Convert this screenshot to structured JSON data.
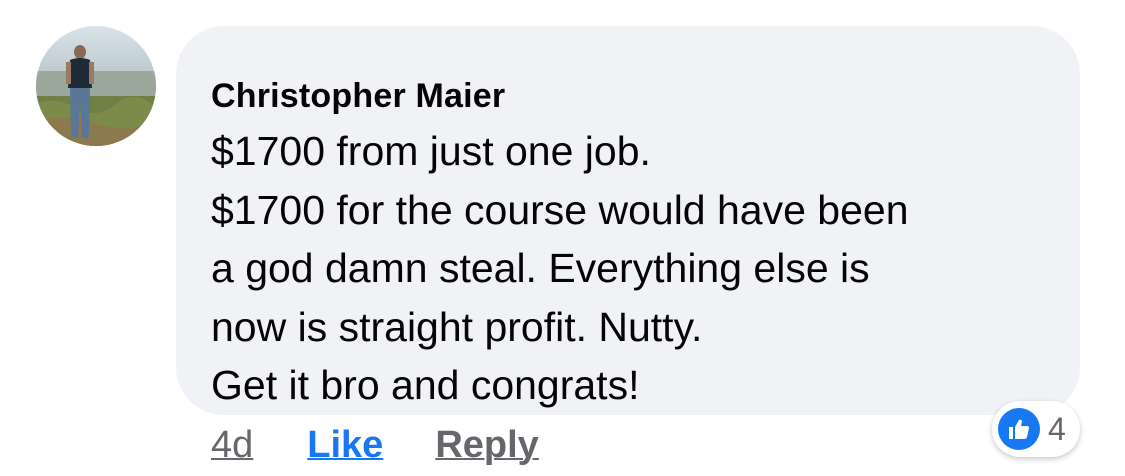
{
  "comment": {
    "author": "Christopher Maier",
    "avatar_icon": "profile-photo",
    "lines": [
      "$1700 from just one job.",
      "$1700 for the course would have been",
      "a god damn steal. Everything else is",
      "now is straight profit. Nutty.",
      "Get it bro and congrats!"
    ],
    "timestamp": "4d",
    "like_label": "Like",
    "reply_label": "Reply",
    "reaction_icon": "thumbs-up-icon",
    "reaction_count": "4"
  },
  "colors": {
    "bubble_bg": "#f0f2f5",
    "text": "#050505",
    "secondary_text": "#65676b",
    "accent": "#1877f2"
  }
}
